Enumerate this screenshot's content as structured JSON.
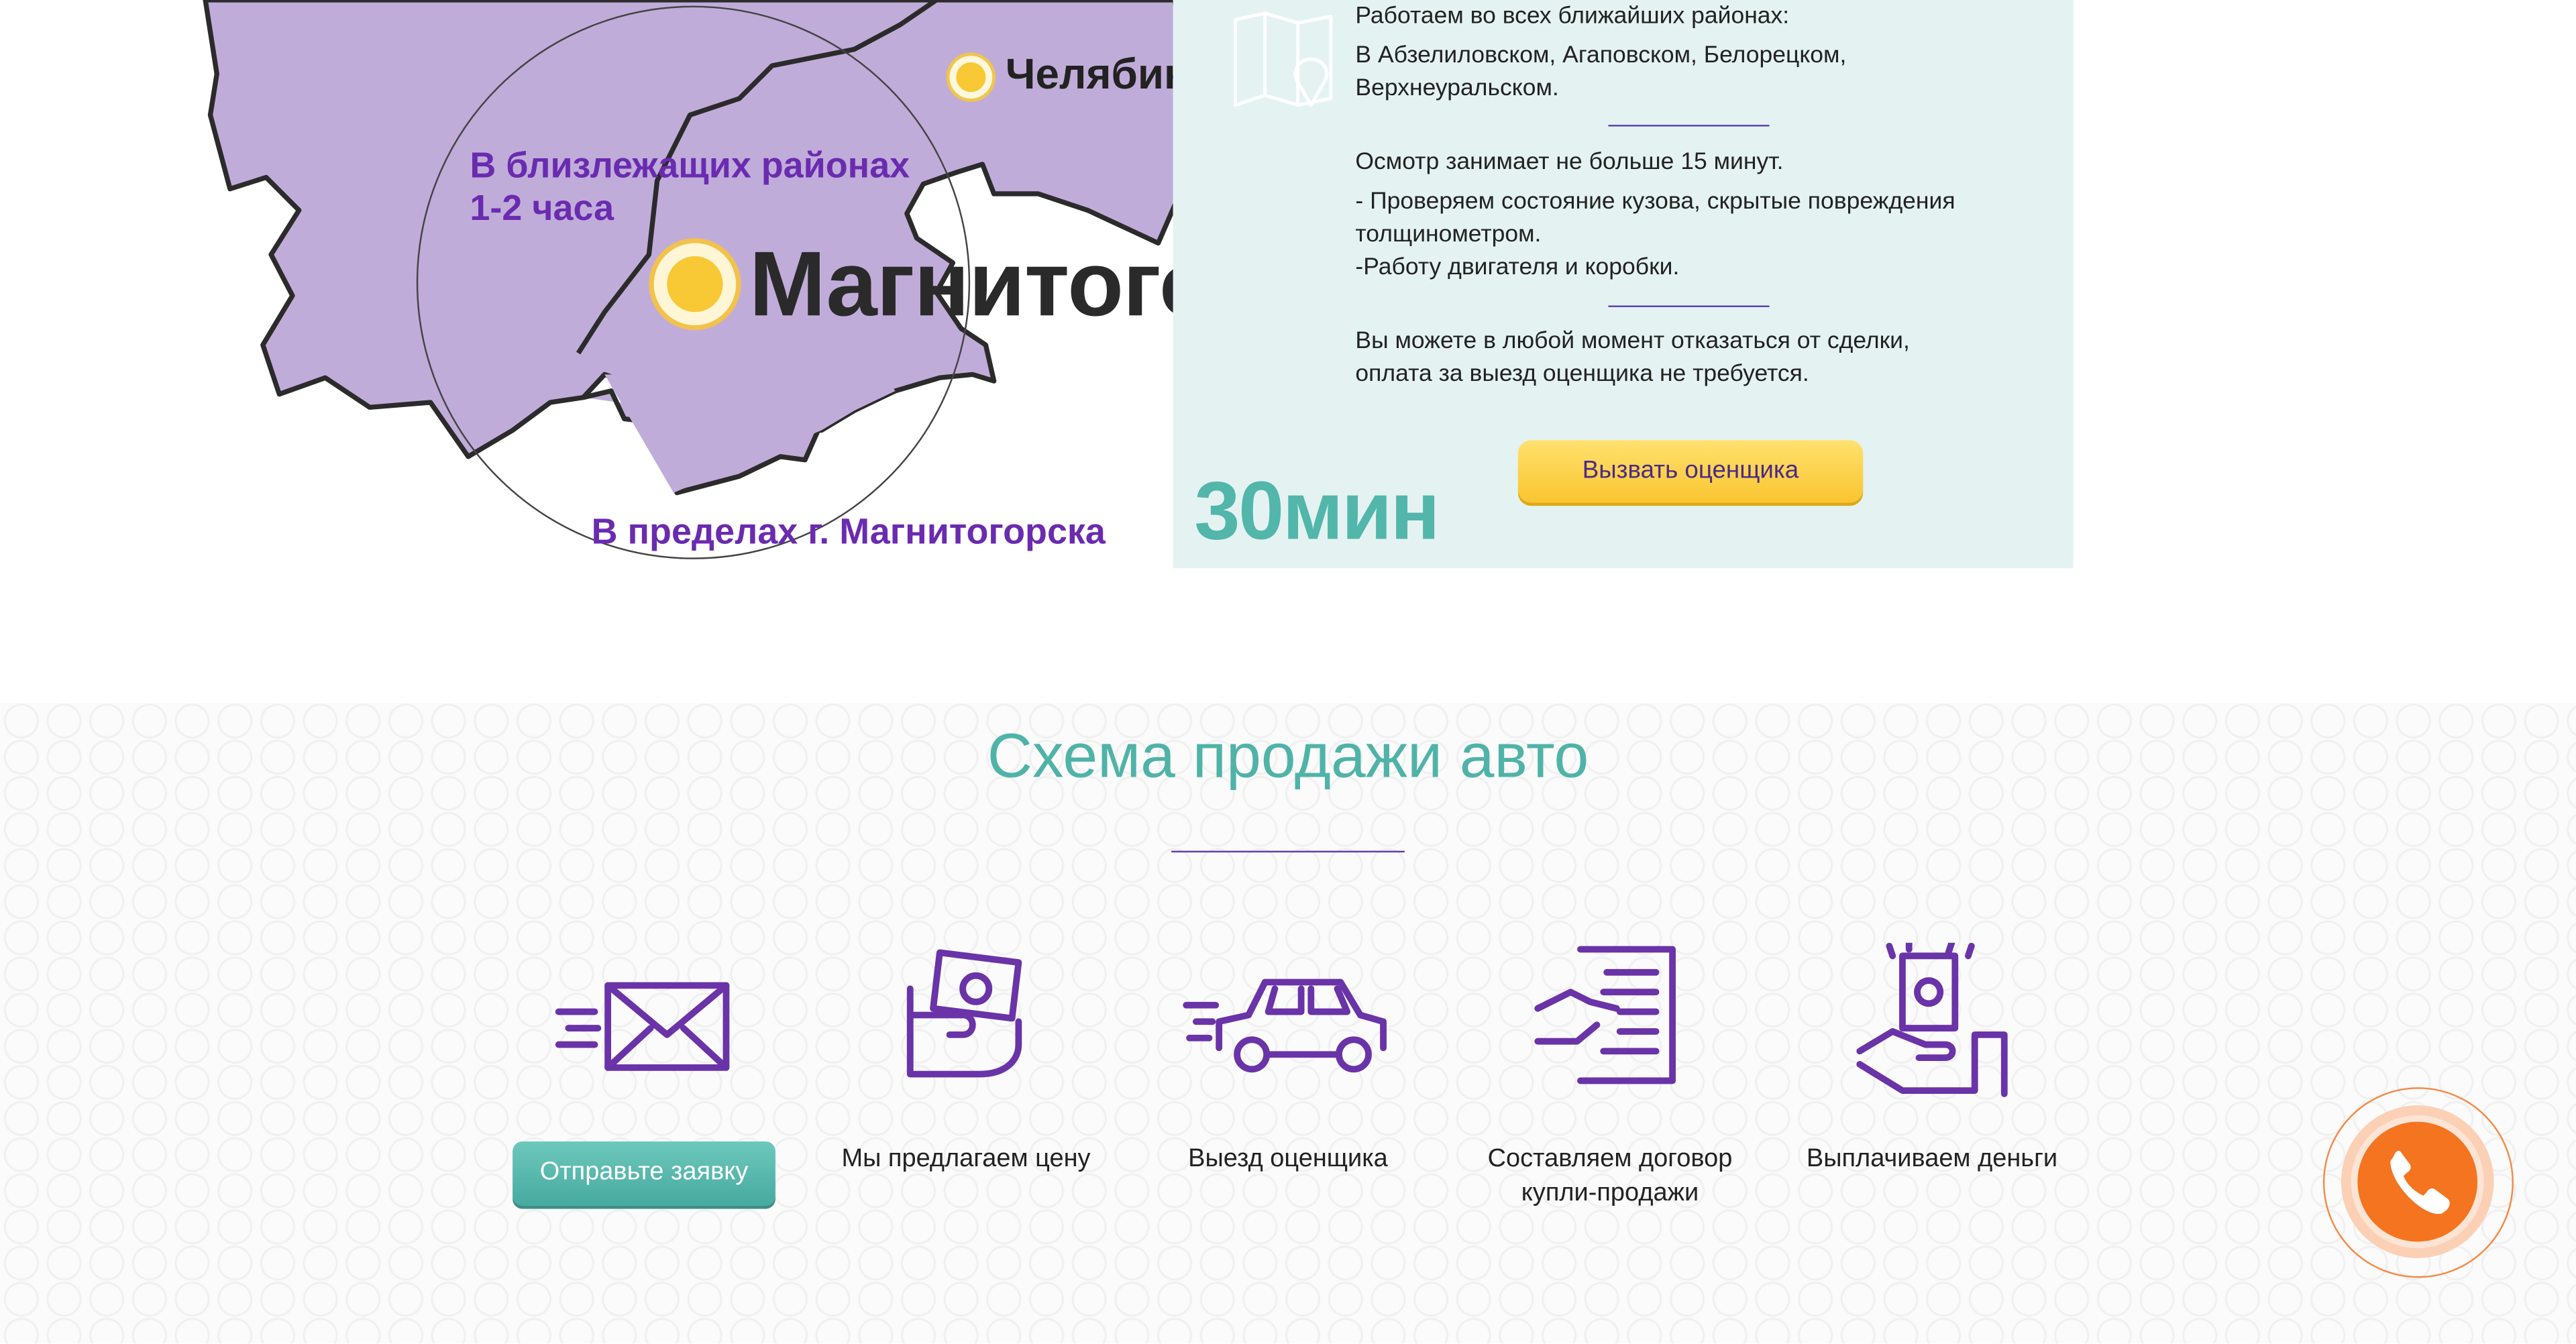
{
  "map": {
    "city_small": "Челябинск",
    "city_big": "Магнитогорск",
    "nearby_label_line1": "В близлежащих районах",
    "nearby_label_line2": "1-2 часа",
    "city_limits_label": "В пределах г. Магнитогорска",
    "colors": {
      "region_fill": "#c0acd9",
      "region_stroke": "#2b2b2b",
      "label_purple": "#6a2bb0"
    }
  },
  "info": {
    "districts_title": "Работаем во всех ближайших районах:",
    "districts_list_1": "В Абзелиловском, Агаповском, Белорецком,",
    "districts_list_2": "Верхнеуральском.",
    "inspection_time": "Осмотр занимает не больше 15 минут.",
    "check_body_1": "- Проверяем состояние кузова, скрытые повреждения",
    "check_body_2": "толщинометром.",
    "check_engine": "-Работу двигателя и коробки.",
    "refuse_1": "Вы можете в любой момент отказаться от сделки,",
    "refuse_2": "оплата за выезд оценщика не требуется.",
    "time_badge": "30мин",
    "call_button": "Вызвать оценщика",
    "icon": "map-icon"
  },
  "scheme": {
    "title": "Схема продажи авто",
    "steps": [
      {
        "icon": "envelope-icon",
        "label": "Отправьте заявку"
      },
      {
        "icon": "money-hand-icon",
        "label": "Мы предлагаем цену"
      },
      {
        "icon": "car-icon",
        "label": "Выезд оценщика"
      },
      {
        "icon": "contract-icon",
        "label_line1": "Составляем договор",
        "label_line2": "купли-продажи"
      },
      {
        "icon": "payout-icon",
        "label": "Выплачиваем деньги"
      }
    ],
    "colors": {
      "title": "#4fb3a8",
      "icons": "#6a33a8",
      "button": "#55b8ad"
    }
  },
  "fab": {
    "icon": "phone-icon",
    "color": "#f4741f"
  }
}
